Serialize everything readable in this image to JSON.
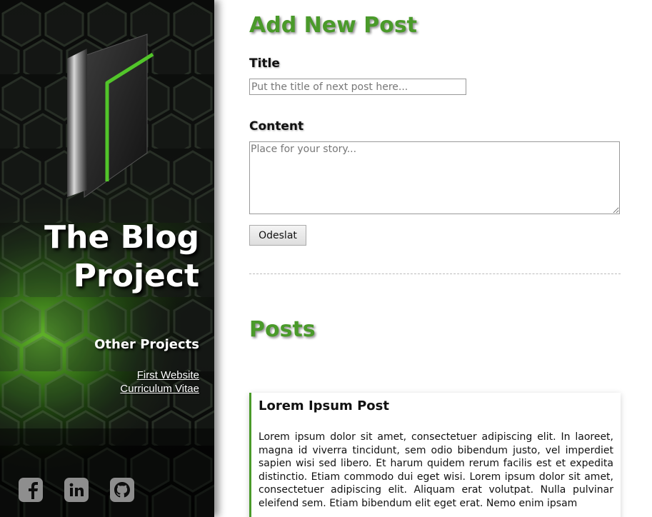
{
  "sidebar": {
    "site_title_line1": "The Blog",
    "site_title_line2": "Project",
    "other_projects_heading": "Other Projects",
    "links": [
      {
        "label": "First Website"
      },
      {
        "label": "Curriculum Vitae"
      }
    ],
    "social_icons": [
      "facebook-icon",
      "linkedin-icon",
      "github-icon"
    ]
  },
  "form": {
    "heading": "Add New Post",
    "title_label": "Title",
    "title_placeholder": "Put the title of next post here...",
    "content_label": "Content",
    "content_placeholder": "Place for your story...",
    "submit_label": "Odeslat"
  },
  "posts": {
    "heading": "Posts",
    "items": [
      {
        "title": "Lorem Ipsum Post",
        "body": "Lorem ipsum dolor sit amet, consectetuer adipiscing elit. In laoreet, magna id viverra tincidunt, sem odio bibendum justo, vel imperdiet sapien wisi sed libero. Et harum quidem rerum facilis est et expedita distinctio. Etiam commodo dui eget wisi. Lorem ipsum dolor sit amet, consectetuer adipiscing elit. Aliquam erat volutpat. Nulla pulvinar eleifend sem. Etiam bibendum elit eget erat. Nemo enim ipsam"
      }
    ]
  },
  "colors": {
    "accent_green": "#4a9a2a",
    "sidebar_bg": "#0c0e0c",
    "icon_gray": "#8e8e8e"
  }
}
